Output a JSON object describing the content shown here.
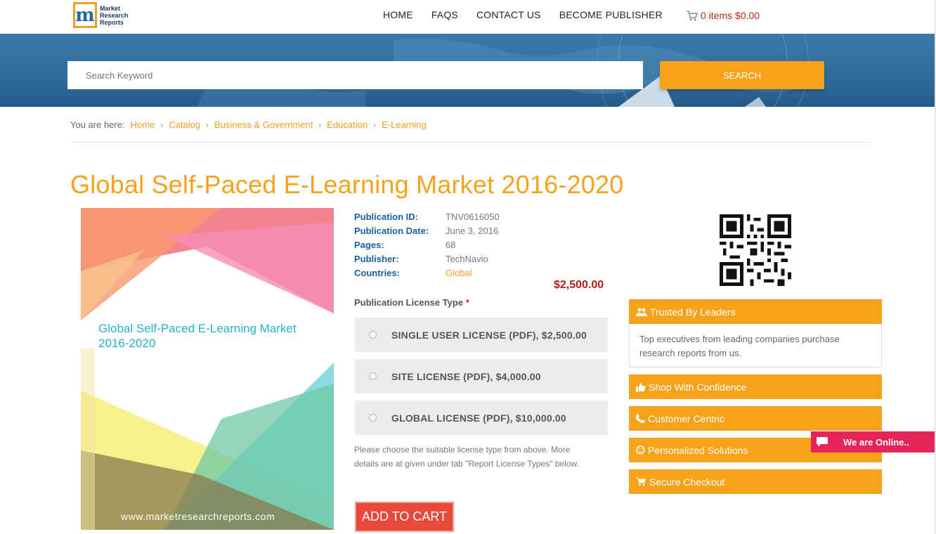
{
  "header": {
    "logo_text": "Market Research Reports",
    "logo_letter": "m",
    "nav": [
      "HOME",
      "FAQS",
      "CONTACT US",
      "BECOME PUBLISHER"
    ],
    "cart_text": "0 items $0.00",
    "cart_icon": "cart-icon"
  },
  "search": {
    "placeholder": "Search Keyword",
    "button_label": "SEARCH"
  },
  "breadcrumb": {
    "prefix": "You are here:",
    "items": [
      "Home",
      "Catalog",
      "Business & Government",
      "Education",
      "E-Learning"
    ],
    "separator": "›"
  },
  "product": {
    "title": "Global Self-Paced E-Learning Market 2016-2020",
    "cover_title": "Global Self-Paced E-Learning Market 2016-2020",
    "cover_url": "www.marketresearchreports.com",
    "meta": [
      {
        "label": "Publication ID:",
        "value": "TNV0616050"
      },
      {
        "label": "Publication Date:",
        "value": "June 3, 2016"
      },
      {
        "label": "Pages:",
        "value": "68"
      },
      {
        "label": "Publisher:",
        "value": "TechNavio"
      },
      {
        "label": "Countries:",
        "value": "Global"
      }
    ],
    "price": "$2,500.00",
    "license_label": "Publication License Type",
    "required_mark": "*",
    "licenses": [
      "SINGLE USER LICENSE (PDF), $2,500.00",
      "SITE LICENSE (PDF), $4,000.00",
      "GLOBAL LICENSE (PDF), $10,000.00"
    ],
    "note": "Please choose the suitable license type from above. More details are at given under tab \"Report License Types\" below.",
    "add_to_cart": "ADD TO CART"
  },
  "sidebar": {
    "trusted_title": "Trusted By Leaders",
    "trusted_body": "Top executives from leading companies purchase research reports from us.",
    "items": [
      {
        "label": "Shop With Confidence",
        "icon": "thumbs-up-icon"
      },
      {
        "label": "Customer Centric",
        "icon": "phone-icon"
      },
      {
        "label": "Personalized Solutions",
        "icon": "smile-icon"
      },
      {
        "label": "Secure Checkout",
        "icon": "cart-icon"
      }
    ]
  },
  "chat": {
    "label": "We are Online.."
  },
  "colors": {
    "accent": "#f7a21b",
    "link_blue": "#1a5fa0",
    "price_red": "#b01e1e",
    "cart_button": "#e8493a",
    "chat_pink": "#e5245a"
  }
}
